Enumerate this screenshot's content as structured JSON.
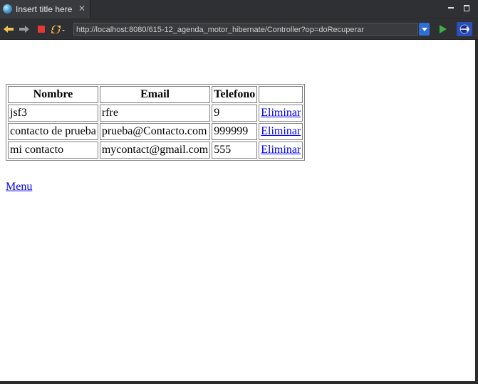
{
  "tab": {
    "title": "Insert title here"
  },
  "toolbar": {
    "url": "http://localhost:8080/615-12_agenda_motor_hibernate/Controller?op=doRecuperar"
  },
  "table": {
    "headers": [
      "Nombre",
      "Email",
      "Telefono",
      ""
    ],
    "rows": [
      {
        "nombre": "jsf3",
        "email": "rfre",
        "telefono": "9",
        "action": "Eliminar"
      },
      {
        "nombre": "contacto de prueba",
        "email": "prueba@Contacto.com",
        "telefono": "999999",
        "action": "Eliminar"
      },
      {
        "nombre": "mi contacto",
        "email": "mycontact@gmail.com",
        "telefono": "555",
        "action": "Eliminar"
      }
    ]
  },
  "menu_link": "Menu",
  "colors": {
    "link": "#0000ee",
    "chrome": "#2f3033",
    "url_dropdown": "#2f6fd6"
  }
}
